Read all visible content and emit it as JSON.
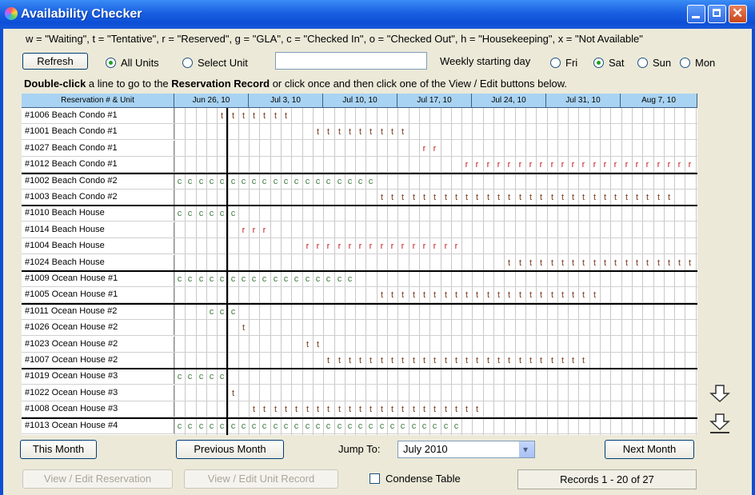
{
  "window": {
    "title": "Availability Checker"
  },
  "legend": "w = \"Waiting\", t = \"Tentative\", r = \"Reserved\", g = \"GLA\", c = \"Checked In\", o = \"Checked Out\", h = \"Housekeeping\", x = \"Not Available\"",
  "controls": {
    "refresh": "Refresh",
    "all_units": "All Units",
    "select_unit": "Select Unit",
    "unit_value": "",
    "weekly_label": "Weekly starting day",
    "days": [
      "Fri",
      "Sat",
      "Sun",
      "Mon"
    ],
    "selected_day": "Sat"
  },
  "instruction": {
    "bold1": "Double-click",
    "text1": " a line to go to the ",
    "bold2": "Reservation Record",
    "text2": " or click once and then click one of the View / Edit buttons below."
  },
  "grid": {
    "header_label": "Reservation # & Unit",
    "weeks": [
      "Jun 26, 10",
      "Jul 3, 10",
      "Jul 10, 10",
      "Jul 17, 10",
      "Jul 24, 10",
      "Jul 31, 10",
      "Aug 7, 10"
    ],
    "rows": [
      {
        "name": "#1006 Beach Condo #1",
        "marks": "t",
        "start": 4,
        "len": 7
      },
      {
        "name": "#1001 Beach Condo #1",
        "marks": "t",
        "start": 13,
        "len": 9
      },
      {
        "name": "#1027 Beach Condo #1",
        "marks": "r",
        "start": 23,
        "len": 2
      },
      {
        "name": "#1012 Beach Condo #1",
        "marks": "r",
        "start": 27,
        "len": 22
      },
      {
        "name": "#1002 Beach Condo #2",
        "marks": "c",
        "start": 0,
        "len": 19
      },
      {
        "name": "#1003 Beach Condo #2",
        "marks": "t",
        "start": 19,
        "len": 28
      },
      {
        "name": "#1010 Beach House",
        "marks": "c",
        "start": 0,
        "len": 6
      },
      {
        "name": "#1014 Beach House",
        "marks": "r",
        "start": 6,
        "len": 3
      },
      {
        "name": "#1004 Beach House",
        "marks": "r",
        "start": 12,
        "len": 15
      },
      {
        "name": "#1024 Beach House",
        "marks": "t",
        "start": 31,
        "len": 18
      },
      {
        "name": "#1009 Ocean House #1",
        "marks": "c",
        "start": 0,
        "len": 17
      },
      {
        "name": "#1005 Ocean House #1",
        "marks": "t",
        "start": 19,
        "len": 21
      },
      {
        "name": "#1011 Ocean House #2",
        "marks": "c",
        "start": 3,
        "len": 3
      },
      {
        "name": "#1026 Ocean House #2",
        "marks": "t",
        "start": 6,
        "len": 1
      },
      {
        "name": "#1023 Ocean House #2",
        "marks": "t",
        "start": 12,
        "len": 2
      },
      {
        "name": "#1007 Ocean House #2",
        "marks": "t",
        "start": 14,
        "len": 25
      },
      {
        "name": "#1019 Ocean House #3",
        "marks": "c",
        "start": 0,
        "len": 5
      },
      {
        "name": "#1022 Ocean House #3",
        "marks": "t",
        "start": 5,
        "len": 1
      },
      {
        "name": "#1008 Ocean House #3",
        "marks": "t",
        "start": 7,
        "len": 22
      },
      {
        "name": "#1013 Ocean House #4",
        "marks": "c",
        "start": 0,
        "len": 27
      }
    ]
  },
  "footer": {
    "this_month": "This Month",
    "previous_month": "Previous Month",
    "jump_to": "Jump To:",
    "jump_value": "July 2010",
    "next_month": "Next Month",
    "view_edit_reservation": "View / Edit Reservation",
    "view_edit_unit": "View / Edit Unit Record",
    "condense": "Condense Table",
    "records": "Records 1 - 20 of 27"
  }
}
